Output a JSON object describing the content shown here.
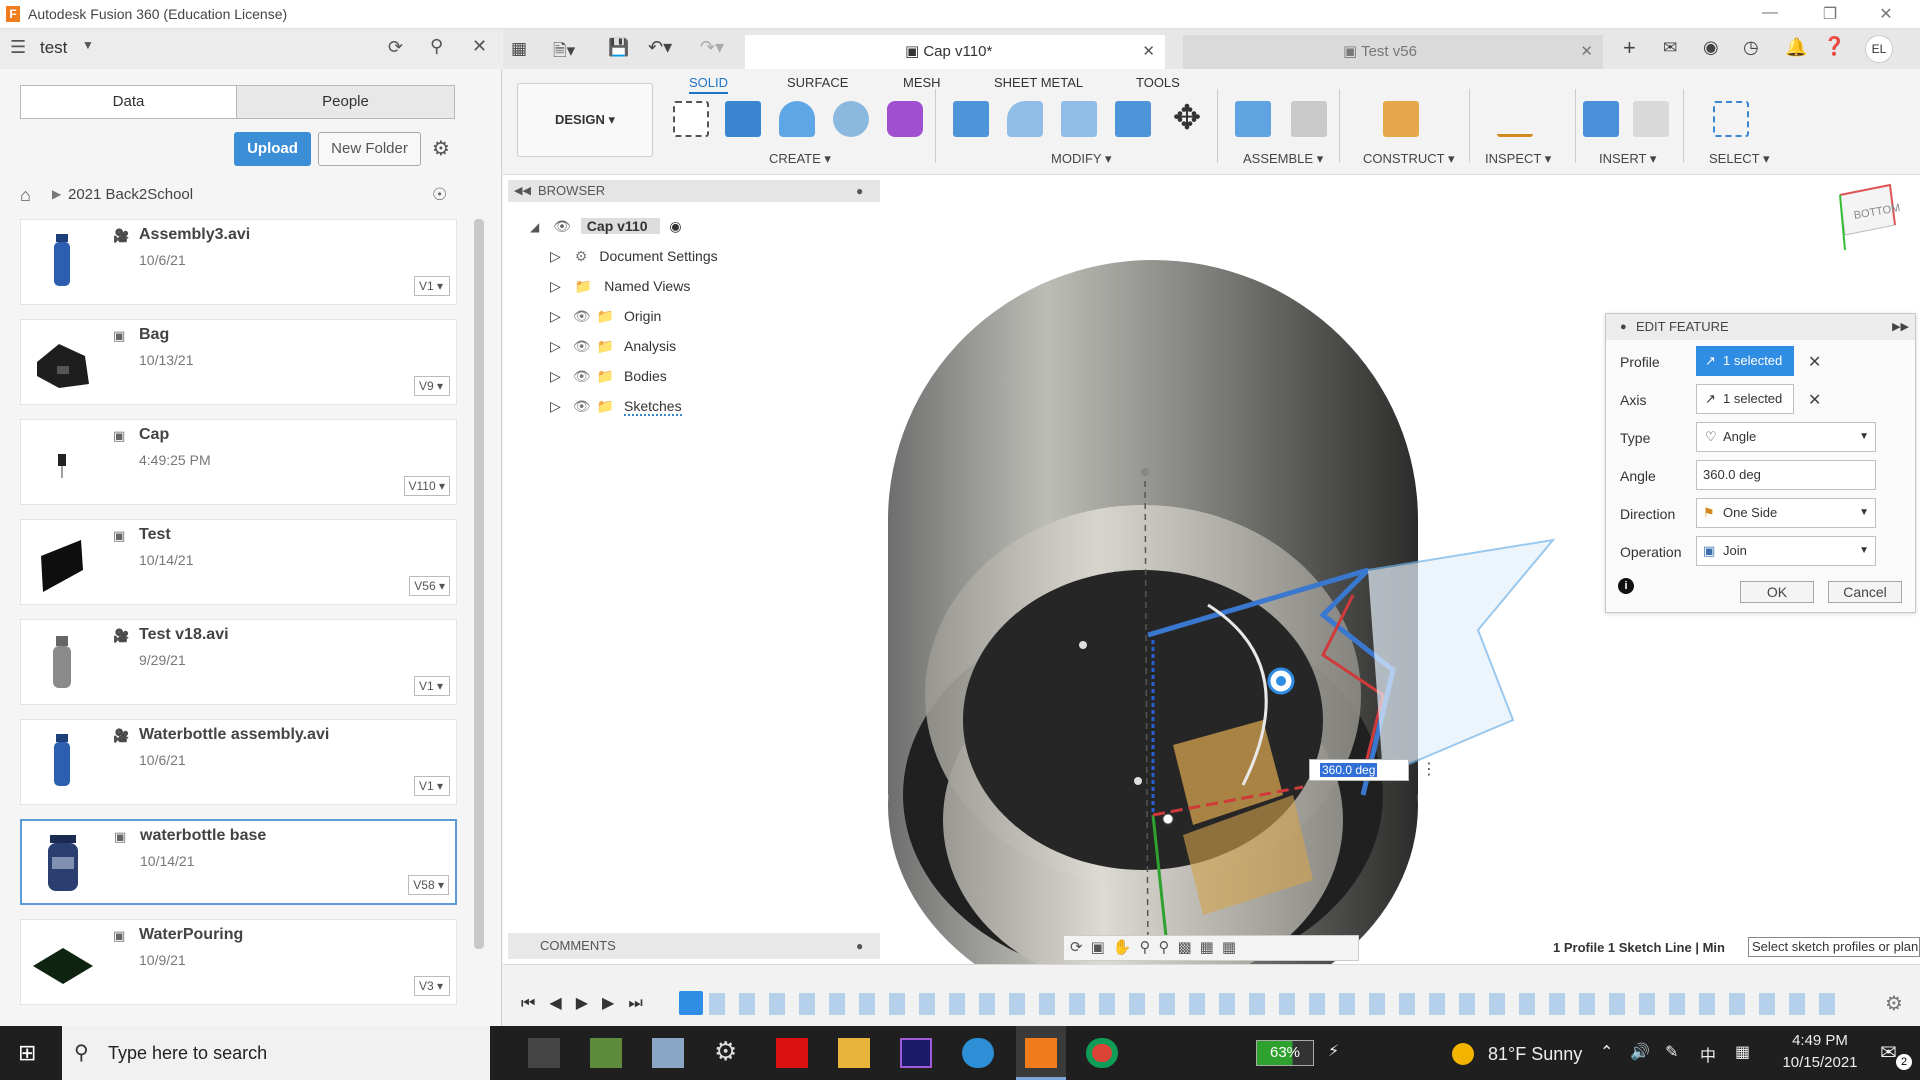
{
  "window": {
    "title": "Autodesk Fusion 360 (Education License)",
    "logo": "F"
  },
  "left_panel": {
    "project": "test",
    "tabs": [
      "Data",
      "People"
    ],
    "upload_label": "Upload",
    "new_folder_label": "New Folder",
    "breadcrumb": "2021 Back2School",
    "files": [
      {
        "name": "Assembly3.avi",
        "date": "10/6/21",
        "version": "V1",
        "kind": "video"
      },
      {
        "name": "Bag",
        "date": "10/13/21",
        "version": "V9",
        "kind": "model"
      },
      {
        "name": "Cap",
        "date": "4:49:25 PM",
        "version": "V110",
        "kind": "model"
      },
      {
        "name": "Test",
        "date": "10/14/21",
        "version": "V56",
        "kind": "model"
      },
      {
        "name": "Test v18.avi",
        "date": "9/29/21",
        "version": "V1",
        "kind": "video"
      },
      {
        "name": "Waterbottle assembly.avi",
        "date": "10/6/21",
        "version": "V1",
        "kind": "video"
      },
      {
        "name": "waterbottle base",
        "date": "10/14/21",
        "version": "V58",
        "kind": "model"
      },
      {
        "name": "WaterPouring",
        "date": "10/9/21",
        "version": "V3",
        "kind": "model"
      }
    ]
  },
  "doc_tabs": [
    {
      "label": "Cap v110*",
      "active": true
    },
    {
      "label": "Test v56",
      "active": false
    }
  ],
  "toolbar": {
    "workspace": "DESIGN",
    "tabs": [
      "SOLID",
      "SURFACE",
      "MESH",
      "SHEET METAL",
      "TOOLS"
    ],
    "groups": [
      "CREATE",
      "MODIFY",
      "ASSEMBLE",
      "CONSTRUCT",
      "INSPECT",
      "INSERT",
      "SELECT"
    ]
  },
  "browser": {
    "title": "BROWSER",
    "root": "Cap v110",
    "items": [
      "Document Settings",
      "Named Views",
      "Origin",
      "Analysis",
      "Bodies",
      "Sketches"
    ]
  },
  "comments_label": "COMMENTS",
  "view_cube_label": "BOTTOM",
  "edit_feature": {
    "title": "EDIT FEATURE",
    "rows": [
      {
        "label": "Profile",
        "value": "1 selected"
      },
      {
        "label": "Axis",
        "value": "1 selected"
      },
      {
        "label": "Type",
        "value": "Angle"
      },
      {
        "label": "Angle",
        "value": "360.0 deg"
      },
      {
        "label": "Direction",
        "value": "One Side"
      },
      {
        "label": "Operation",
        "value": "Join"
      }
    ],
    "ok": "OK",
    "cancel": "Cancel"
  },
  "angle_input": "360.0 deg",
  "status_text": "1 Profile 1 Sketch Line | Min",
  "status_hint": "Select sketch profiles or plan",
  "taskbar": {
    "search_placeholder": "Type here to search",
    "battery": "63%",
    "weather": "81°F  Sunny",
    "ime": "中",
    "time": "4:49 PM",
    "date": "10/15/2021",
    "notifications": "2"
  }
}
